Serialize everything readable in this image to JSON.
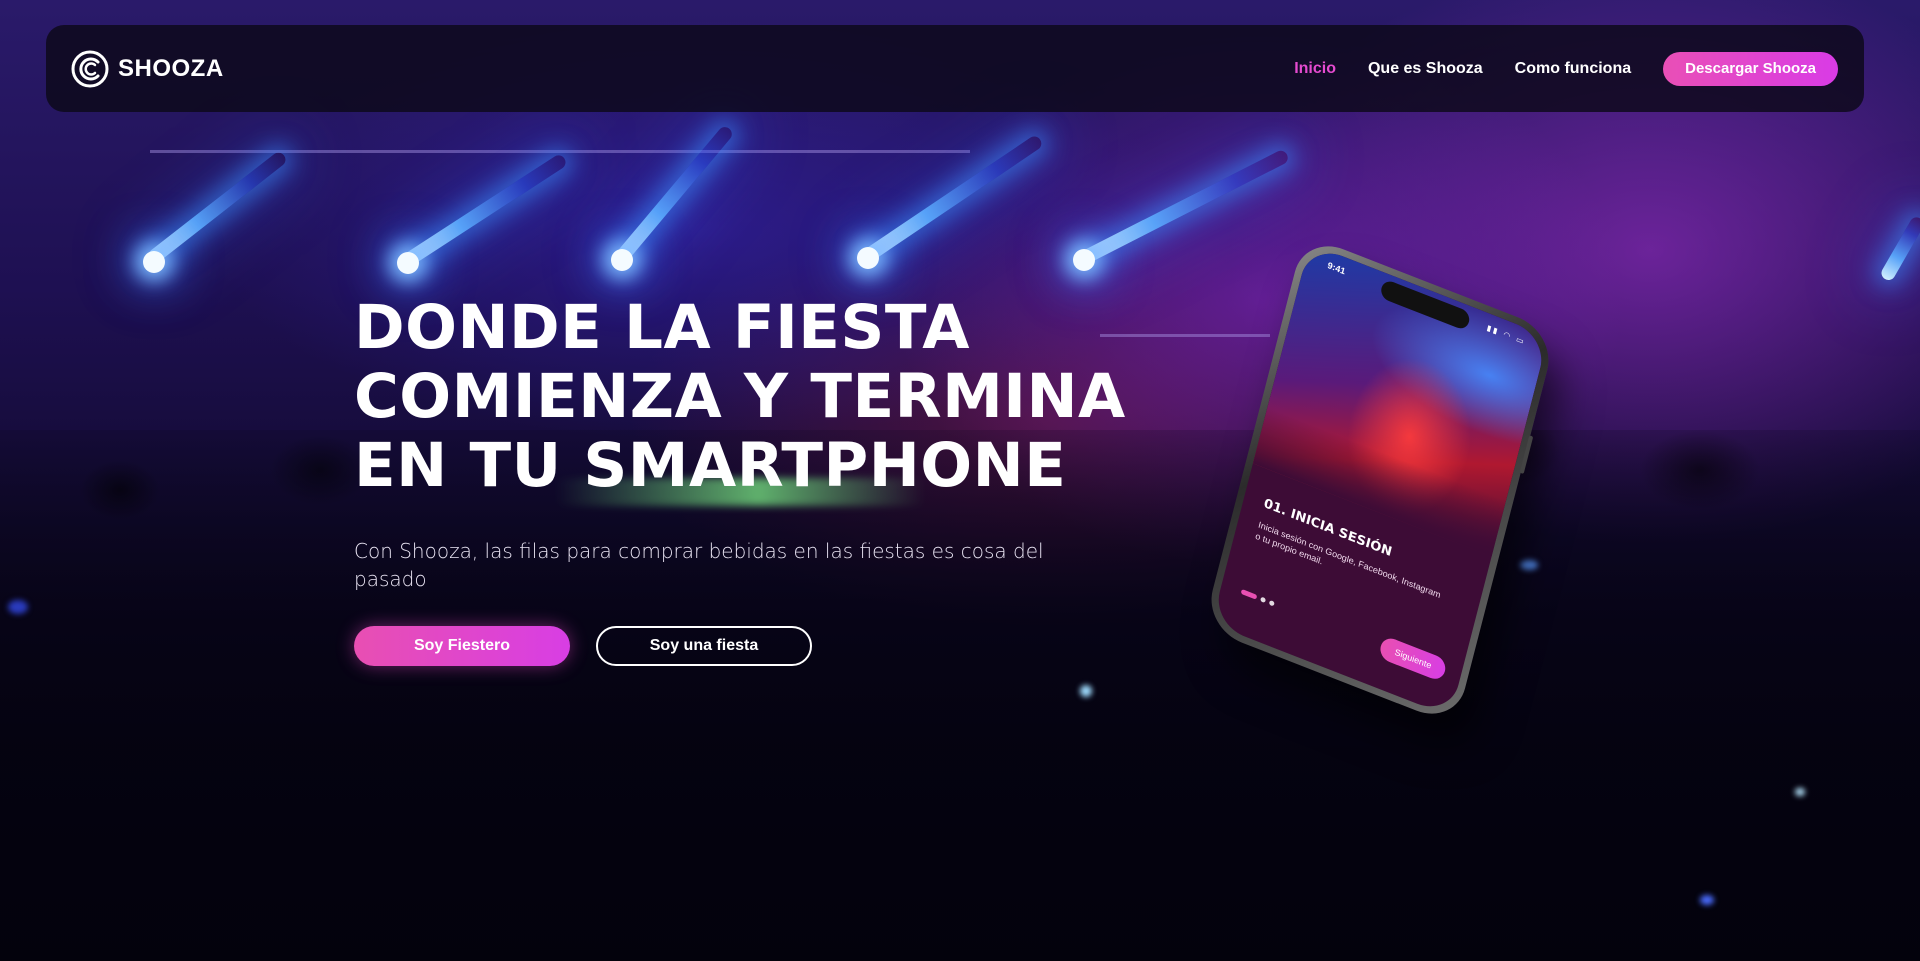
{
  "brand": {
    "name": "SHOOZA",
    "logo_icon": "shooza-swirl-logo"
  },
  "nav": {
    "links": [
      {
        "label": "Inicio",
        "active": true
      },
      {
        "label": "Que es Shooza",
        "active": false
      },
      {
        "label": "Como funciona",
        "active": false
      }
    ],
    "cta_label": "Descargar Shooza"
  },
  "hero": {
    "title_lines": [
      "DONDE LA FIESTA",
      "COMIENZA Y TERMINA",
      "EN TU",
      "SMARTPHONE"
    ],
    "subtitle": "Con Shooza, las filas para comprar bebidas en las fiestas es cosa del pasado",
    "primary_button": "Soy Fiestero",
    "secondary_button": "Soy una fiesta"
  },
  "phone": {
    "status_time": "9:41",
    "step_title": "01. INICIA SESIÓN",
    "step_desc": "Inicia sesión con Google, Facebook, Instagram o tu propio email.",
    "next_button": "Siguiente"
  },
  "colors": {
    "accent": "#e54bd0",
    "button_gradient_start": "#e84fb2",
    "button_gradient_end": "#d83ee4",
    "highlight": "#82ff8c",
    "navbar_bg": "#0c0818"
  }
}
